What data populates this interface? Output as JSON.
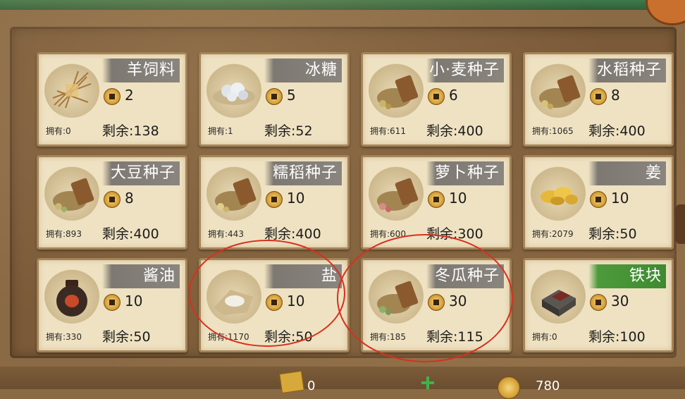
{
  "shop": {
    "items": [
      {
        "name": "羊饲料",
        "price": "2",
        "own": "拥有:0",
        "remain": "剩余:138",
        "icon": "hay-feed-icon"
      },
      {
        "name": "冰糖",
        "price": "5",
        "own": "拥有:1",
        "remain": "剩余:52",
        "icon": "rock-sugar-icon"
      },
      {
        "name": "小·麦种子",
        "price": "6",
        "own": "拥有:611",
        "remain": "剩余:400",
        "icon": "seed-bag-icon"
      },
      {
        "name": "水稻种子",
        "price": "8",
        "own": "拥有:1065",
        "remain": "剩余:400",
        "icon": "seed-bag-icon"
      },
      {
        "name": "大豆种子",
        "price": "8",
        "own": "拥有:893",
        "remain": "剩余:400",
        "icon": "seed-bag-icon"
      },
      {
        "name": "糯稻种子",
        "price": "10",
        "own": "拥有:443",
        "remain": "剩余:400",
        "icon": "seed-bag-icon"
      },
      {
        "name": "萝卜种子",
        "price": "10",
        "own": "拥有:600",
        "remain": "剩余:300",
        "icon": "seed-bag-icon"
      },
      {
        "name": "姜",
        "price": "10",
        "own": "拥有:2079",
        "remain": "剩余:50",
        "icon": "ginger-icon"
      },
      {
        "name": "酱油",
        "price": "10",
        "own": "拥有:330",
        "remain": "剩余:50",
        "icon": "soy-sauce-jar-icon"
      },
      {
        "name": "盐",
        "price": "10",
        "own": "拥有:1170",
        "remain": "剩余:50",
        "icon": "salt-icon"
      },
      {
        "name": "冬瓜种子",
        "price": "30",
        "own": "拥有:185",
        "remain": "剩余:115",
        "icon": "seed-bag-icon"
      },
      {
        "name": "铁块",
        "price": "30",
        "own": "拥有:0",
        "remain": "剩余:100",
        "icon": "iron-block-icon"
      }
    ]
  },
  "bottom": {
    "ticket_value": "0",
    "coin_value": "780"
  },
  "colors": {
    "title_plate": "#8a857e",
    "title_plate_highlight": "#3f8a30",
    "annotation_circle": "#d83020"
  }
}
